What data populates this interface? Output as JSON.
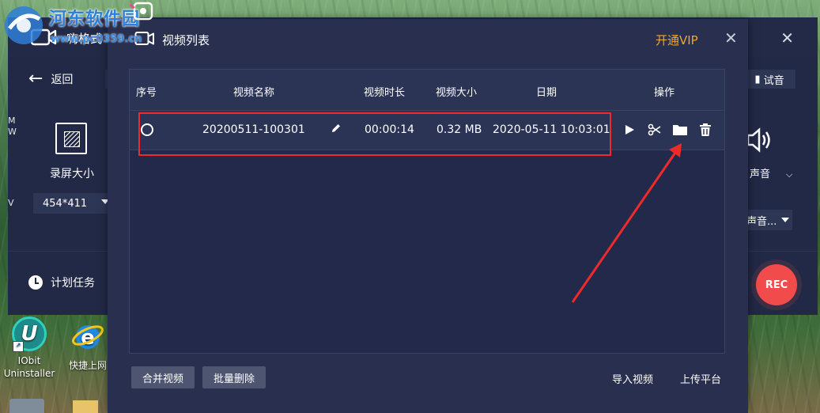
{
  "watermark": {
    "site_name": "河东软件园",
    "url": "www.pc0359.cn"
  },
  "background_app": {
    "title": "嗨格式",
    "back_label": "返回",
    "screen_size_label": "录屏大小",
    "screen_size_value": "454*411",
    "schedule_label": "计划任务",
    "trial_label": "试音",
    "audio_label": "声音",
    "audio_select": "声音...",
    "rec_label": "REC",
    "left_fragment_1": "M",
    "left_fragment_2": "W",
    "left_fragment_3": "V"
  },
  "dialog": {
    "title": "视频列表",
    "vip_label": "开通VIP",
    "close_label": "✕",
    "table": {
      "headers": [
        "序号",
        "视频名称",
        "视频时长",
        "视频大小",
        "日期",
        "操作"
      ],
      "rows": [
        {
          "name": "20200511-100301",
          "duration": "00:00:14",
          "size": "0.32 MB",
          "date": "2020-05-11 10:03:01"
        }
      ]
    },
    "buttons": {
      "merge": "合并视频",
      "batch_delete": "批量删除",
      "import": "导入视频",
      "upload": "上传平台"
    }
  },
  "desktop": {
    "icons": [
      {
        "label_line1": "IObit",
        "label_line2": "Uninstaller"
      },
      {
        "label_line1": "快捷上网",
        "label_line2": ""
      }
    ]
  },
  "colors": {
    "accent_vip": "#f5a623",
    "rec": "#f24b4b",
    "annotation_red": "#ee2a2a",
    "dialog_bg": "#282f4f"
  }
}
